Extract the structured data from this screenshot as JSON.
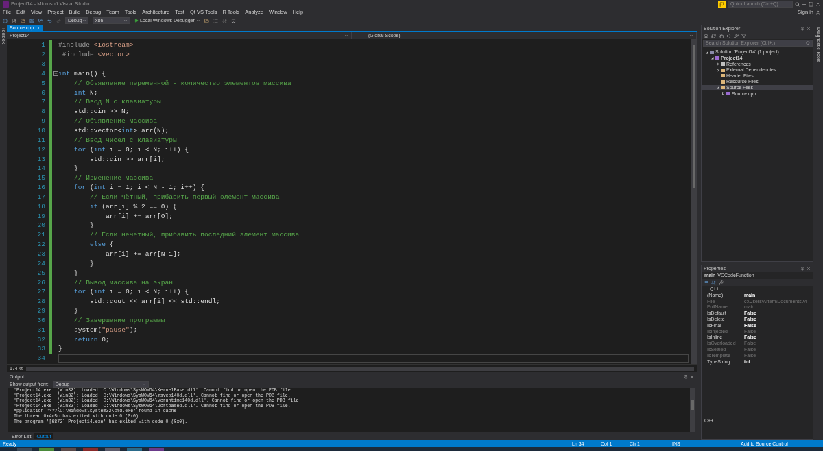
{
  "window": {
    "title": "Project14 - Microsoft Visual Studio"
  },
  "quick_launch": {
    "placeholder": "Quick Launch (Ctrl+Q)"
  },
  "menu": [
    "File",
    "Edit",
    "View",
    "Project",
    "Build",
    "Debug",
    "Team",
    "Tools",
    "Architecture",
    "Test",
    "Qt VS Tools",
    "R Tools",
    "Analyze",
    "Window",
    "Help"
  ],
  "sign_in": "Sign in",
  "toolbar": {
    "configuration": "Debug",
    "platform": "x86",
    "run": "Local Windows Debugger"
  },
  "side_strip": "Toolbox",
  "editor": {
    "tabs": [
      {
        "label": "Source.cpp",
        "selected": true
      }
    ],
    "project": "Project14",
    "scope": "(Global Scope)",
    "zoom": "174 %",
    "lines": [
      {
        "n": "1",
        "changed": true,
        "tokens": [
          {
            "kind": "pre",
            "text": "#include "
          },
          {
            "kind": "str",
            "text": "<iostream>"
          }
        ]
      },
      {
        "n": "2",
        "changed": true,
        "tokens": [
          {
            "kind": "pre",
            "text": " #include "
          },
          {
            "kind": "str",
            "text": "<vector>"
          }
        ]
      },
      {
        "n": "3",
        "changed": true
      },
      {
        "n": "4",
        "changed": true,
        "fold": true,
        "tokens": [
          {
            "kind": "kw",
            "text": "int"
          },
          {
            "kind": "plain",
            "text": " main() {"
          }
        ]
      },
      {
        "n": "5",
        "changed": true,
        "tokens": [
          {
            "kind": "comment",
            "text": "    // Объявление переменной - количество элементов массива"
          }
        ]
      },
      {
        "n": "6",
        "changed": true,
        "tokens": [
          {
            "kind": "kw",
            "text": "    int"
          },
          {
            "kind": "plain",
            "text": " N;"
          }
        ]
      },
      {
        "n": "7",
        "changed": true,
        "tokens": [
          {
            "kind": "comment",
            "text": "    // Ввод N с клавиатуры"
          }
        ]
      },
      {
        "n": "8",
        "changed": true,
        "tokens": [
          {
            "kind": "plain",
            "text": "    std::cin >> N;"
          }
        ]
      },
      {
        "n": "9",
        "changed": true,
        "tokens": [
          {
            "kind": "comment",
            "text": "    // Объявление массива"
          }
        ]
      },
      {
        "n": "10",
        "changed": true,
        "tokens": [
          {
            "kind": "plain",
            "text": "    std::vector<"
          },
          {
            "kind": "kw",
            "text": "int"
          },
          {
            "kind": "plain",
            "text": "> arr(N);"
          }
        ]
      },
      {
        "n": "11",
        "changed": true,
        "tokens": [
          {
            "kind": "comment",
            "text": "    // Ввод чисел с клавиатуры"
          }
        ]
      },
      {
        "n": "12",
        "changed": true,
        "tokens": [
          {
            "kind": "kw",
            "text": "    for"
          },
          {
            "kind": "plain",
            "text": " ("
          },
          {
            "kind": "kw",
            "text": "int"
          },
          {
            "kind": "plain",
            "text": " i = 0; i < N; i++) {"
          }
        ]
      },
      {
        "n": "13",
        "changed": true,
        "tokens": [
          {
            "kind": "plain",
            "text": "        std::cin >> arr[i];"
          }
        ]
      },
      {
        "n": "14",
        "changed": true,
        "tokens": [
          {
            "kind": "plain",
            "text": "    }"
          }
        ]
      },
      {
        "n": "15",
        "changed": true,
        "tokens": [
          {
            "kind": "comment",
            "text": "    // Изменение массива"
          }
        ]
      },
      {
        "n": "16",
        "changed": true,
        "tokens": [
          {
            "kind": "kw",
            "text": "    for"
          },
          {
            "kind": "plain",
            "text": " ("
          },
          {
            "kind": "kw",
            "text": "int"
          },
          {
            "kind": "plain",
            "text": " i = 1; i < N - 1; i++) {"
          }
        ]
      },
      {
        "n": "17",
        "changed": true,
        "tokens": [
          {
            "kind": "comment",
            "text": "        // Если чётный, прибавить первый элемент массива"
          }
        ]
      },
      {
        "n": "18",
        "changed": true,
        "tokens": [
          {
            "kind": "kw",
            "text": "        if"
          },
          {
            "kind": "plain",
            "text": " (arr[i] % 2 == 0) {"
          }
        ]
      },
      {
        "n": "19",
        "changed": true,
        "tokens": [
          {
            "kind": "plain",
            "text": "            arr[i] += arr[0];"
          }
        ]
      },
      {
        "n": "20",
        "changed": true,
        "tokens": [
          {
            "kind": "plain",
            "text": "        }"
          }
        ]
      },
      {
        "n": "21",
        "changed": true,
        "tokens": [
          {
            "kind": "comment",
            "text": "        // Если нечётный, прибавить последний элемент массива"
          }
        ]
      },
      {
        "n": "22",
        "changed": true,
        "tokens": [
          {
            "kind": "kw",
            "text": "        else"
          },
          {
            "kind": "plain",
            "text": " {"
          }
        ]
      },
      {
        "n": "23",
        "changed": true,
        "tokens": [
          {
            "kind": "plain",
            "text": "            arr[i] += arr[N-1];"
          }
        ]
      },
      {
        "n": "24",
        "changed": true,
        "tokens": [
          {
            "kind": "plain",
            "text": "        }"
          }
        ]
      },
      {
        "n": "25",
        "changed": true,
        "tokens": [
          {
            "kind": "plain",
            "text": "    }"
          }
        ]
      },
      {
        "n": "26",
        "changed": true,
        "tokens": [
          {
            "kind": "comment",
            "text": "    // Вывод массива на экран"
          }
        ]
      },
      {
        "n": "27",
        "changed": true,
        "tokens": [
          {
            "kind": "kw",
            "text": "    for"
          },
          {
            "kind": "plain",
            "text": " ("
          },
          {
            "kind": "kw",
            "text": "int"
          },
          {
            "kind": "plain",
            "text": " i = 0; i < N; i++) {"
          }
        ]
      },
      {
        "n": "28",
        "changed": true,
        "tokens": [
          {
            "kind": "plain",
            "text": "        std::cout << arr[i] << std::endl;"
          }
        ]
      },
      {
        "n": "29",
        "changed": true,
        "tokens": [
          {
            "kind": "plain",
            "text": "    }"
          }
        ]
      },
      {
        "n": "30",
        "changed": true,
        "tokens": [
          {
            "kind": "comment",
            "text": "    // Завершение программы"
          }
        ]
      },
      {
        "n": "31",
        "changed": true,
        "tokens": [
          {
            "kind": "plain",
            "text": "    system("
          },
          {
            "kind": "str",
            "text": "\"pause\""
          },
          {
            "kind": "plain",
            "text": ");"
          }
        ]
      },
      {
        "n": "32",
        "changed": true,
        "tokens": [
          {
            "kind": "kw",
            "text": "    return"
          },
          {
            "kind": "plain",
            "text": " 0;"
          }
        ]
      },
      {
        "n": "33",
        "changed": true,
        "tokens": [
          {
            "kind": "plain",
            "text": "}"
          }
        ]
      },
      {
        "n": "34",
        "changed": false,
        "current": true
      }
    ]
  },
  "output": {
    "title": "Output",
    "source_label": "Show output from:",
    "source": "Debug",
    "lines": [
      "'Project14.exe' (Win32): Loaded 'C:\\Windows\\SysWOW64\\KernelBase.dll'. Cannot find or open the PDB file.",
      "'Project14.exe' (Win32): Loaded 'C:\\Windows\\SysWOW64\\msvcp140d.dll'. Cannot find or open the PDB file.",
      "'Project14.exe' (Win32): Loaded 'C:\\Windows\\SysWOW64\\vcruntime140d.dll'. Cannot find or open the PDB file.",
      "'Project14.exe' (Win32): Loaded 'C:\\Windows\\SysWOW64\\ucrtbased.dll'. Cannot find or open the PDB file.",
      "Application \"\\??\\C:\\Windows\\system32\\cmd.exe\" found in cache",
      "The thread 0x4c5c has exited with code 0 (0x0).",
      "The program '[6872] Project14.exe' has exited with code 0 (0x0)."
    ],
    "tabs": [
      {
        "label": "Error List",
        "selected": false
      },
      {
        "label": "Output",
        "selected": true
      }
    ]
  },
  "solution_explorer": {
    "title": "Solution Explorer",
    "search_placeholder": "Search Solution Explorer (Ctrl+;)",
    "tree": [
      {
        "label": "Solution 'Project14' (1 project)",
        "kind": "solution",
        "expanded": true,
        "selected": false,
        "children": [
          {
            "label": "Project14",
            "kind": "project",
            "expanded": true,
            "selected": false,
            "children": [
              {
                "label": "References",
                "kind": "references",
                "expanded": false,
                "selected": false
              },
              {
                "label": "External Dependencies",
                "kind": "folder",
                "expanded": false,
                "selected": false
              },
              {
                "label": "Header Files",
                "kind": "folder",
                "selected": false
              },
              {
                "label": "Resource Files",
                "kind": "folder",
                "selected": false
              },
              {
                "label": "Source Files",
                "kind": "folder",
                "expanded": true,
                "selected": true,
                "children": [
                  {
                    "label": "Source.cpp",
                    "kind": "file",
                    "expanded": false,
                    "selected": false
                  }
                ]
              }
            ]
          }
        ]
      }
    ]
  },
  "side_strip_right": "Diagnostic Tools",
  "properties": {
    "title": "Properties",
    "object": "main",
    "object_type": "VCCodeFunction",
    "category": "C++",
    "rows": [
      {
        "name": "(Name)",
        "value": "main",
        "disabled": false
      },
      {
        "name": "File",
        "value": "c:\\Users\\Artem\\Documents\\Vi",
        "disabled": true
      },
      {
        "name": "FullName",
        "value": "main",
        "disabled": true
      },
      {
        "name": "IsDefault",
        "value": "False",
        "disabled": false
      },
      {
        "name": "IsDelete",
        "value": "False",
        "disabled": false
      },
      {
        "name": "IsFinal",
        "value": "False",
        "disabled": false
      },
      {
        "name": "IsInjected",
        "value": "False",
        "disabled": true
      },
      {
        "name": "IsInline",
        "value": "False",
        "disabled": false
      },
      {
        "name": "IsOverloaded",
        "value": "False",
        "disabled": true
      },
      {
        "name": "IsSealed",
        "value": "False",
        "disabled": true
      },
      {
        "name": "IsTemplate",
        "value": "False",
        "disabled": true
      },
      {
        "name": "TypeString",
        "value": "int",
        "disabled": false
      }
    ],
    "description": "C++"
  },
  "status_bar": {
    "state": "Ready",
    "line": "Ln 34",
    "column": "Col 1",
    "char": "Ch 1",
    "mode": "INS",
    "source_control": "Add to Source Control"
  }
}
